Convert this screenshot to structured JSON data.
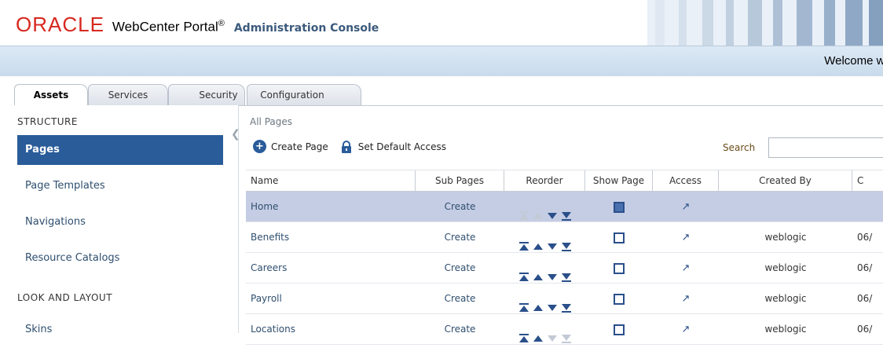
{
  "header": {
    "logo_text": "ORACLE",
    "product_name": "WebCenter Portal",
    "registered_mark": "®",
    "console_title": "Administration Console",
    "welcome_text": "Welcome weblogic"
  },
  "tabs": [
    {
      "label": "Assets",
      "active": true
    },
    {
      "label": "Services",
      "active": false
    },
    {
      "label": "Security",
      "active": false
    },
    {
      "label": "Configuration",
      "active": false
    }
  ],
  "sidebar": {
    "heading_structure": "Structure",
    "items": [
      {
        "label": "Pages",
        "selected": true
      },
      {
        "label": "Page Templates",
        "selected": false
      },
      {
        "label": "Navigations",
        "selected": false
      },
      {
        "label": "Resource Catalogs",
        "selected": false
      }
    ],
    "heading_look": "Look and Layout",
    "skins_label": "Skins"
  },
  "main": {
    "breadcrumb": "All Pages",
    "create_page_label": "Create Page",
    "set_default_access_label": "Set Default Access",
    "search_label": "Search",
    "search_value": ""
  },
  "table": {
    "columns": [
      "Name",
      "Sub Pages",
      "Reorder",
      "Show Page",
      "Access",
      "Created By",
      "C"
    ],
    "rows": [
      {
        "name": "Home",
        "sub_pages": "Create",
        "show_page": true,
        "created_by": "",
        "date": ""
      },
      {
        "name": "Benefits",
        "sub_pages": "Create",
        "show_page": false,
        "created_by": "weblogic",
        "date": "06/"
      },
      {
        "name": "Careers",
        "sub_pages": "Create",
        "show_page": false,
        "created_by": "weblogic",
        "date": "06/"
      },
      {
        "name": "Payroll",
        "sub_pages": "Create",
        "show_page": false,
        "created_by": "weblogic",
        "date": "06/"
      },
      {
        "name": "Locations",
        "sub_pages": "Create",
        "show_page": false,
        "created_by": "weblogic",
        "date": "06/"
      }
    ]
  },
  "colors": {
    "oracle_red": "#d7281f",
    "selected_nav": "#2a5c9a",
    "selected_row": "#c5cde4",
    "link": "#2f4f6f"
  }
}
